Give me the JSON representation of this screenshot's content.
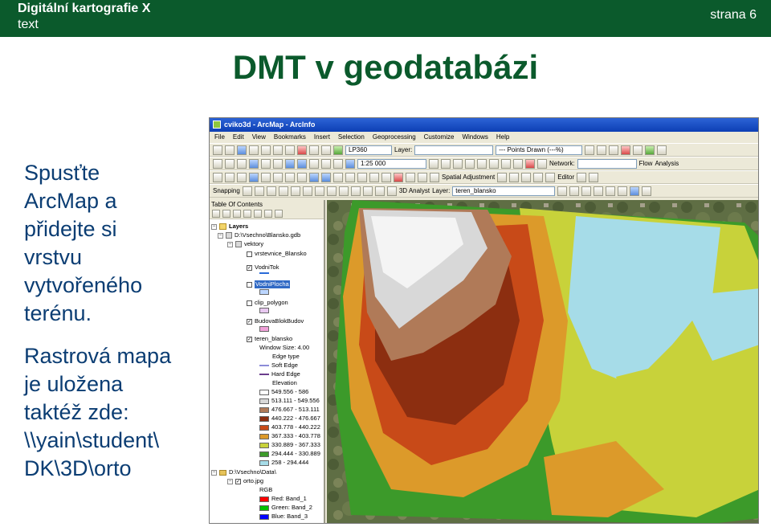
{
  "slide": {
    "course_title": "Digitální kartografie X",
    "subtitle": "text",
    "page_label": "strana 6",
    "heading": "DMT v geodatabázi",
    "paragraph1": "Spusťte\nArcMap a\npřidejte si\nvrstvu\nvytvořeného\nterénu.",
    "paragraph2": "Rastrová mapa\nje uložena\ntaktéž zde:\n\\\\yain\\student\\\nDK\\3D\\orto"
  },
  "arcmap": {
    "window_title": "cviko3d - ArcMap - ArcInfo",
    "menu": [
      "File",
      "Edit",
      "View",
      "Bookmarks",
      "Insert",
      "Selection",
      "Geoprocessing",
      "Customize",
      "Windows",
      "Help"
    ],
    "toolbar": {
      "layer_combo": "LP360",
      "layer_label": "Layer:",
      "points_drawn": "--- Points Drawn (---%)",
      "scale": "1:25 000",
      "network_label": "Network:",
      "flow_label": "Flow",
      "analysis_label": "Analysis",
      "snapping_label": "Snapping",
      "spatial_adjustment_label": "Spatial Adjustment",
      "editor_label": "Editor",
      "analyst_3d_label": "3D Analyst",
      "analyst_layer_label": "Layer:",
      "analyst_layer_value": "teren_blansko"
    },
    "toc": {
      "title": "Table Of Contents",
      "layers_root": "Layers",
      "gdb_path": "D:\\Vsechno\\Blansko.gdb",
      "vektory": "vektory",
      "vrstevnice": "vrstevnice_Blansko",
      "vodnitok": "VodniTok",
      "vodniplocha": "VodniPlocha",
      "clip_polygon": "clip_polygon",
      "budova": "BudovaBlokBudov",
      "teren": "teren_blansko",
      "window_size": "Window Size: 4.00",
      "edge_type": "Edge type",
      "soft_edge": "Soft Edge",
      "hard_edge": "Hard Edge",
      "elevation": "Elevation",
      "elevation_classes": [
        {
          "label": "549.556 - 586",
          "color": "#ffffff"
        },
        {
          "label": "513.111 - 549.556",
          "color": "#d8d8d8"
        },
        {
          "label": "476.667 - 513.111",
          "color": "#b07a58"
        },
        {
          "label": "440.222 - 476.667",
          "color": "#8c2e10"
        },
        {
          "label": "403.778 - 440.222",
          "color": "#c84a18"
        },
        {
          "label": "367.333 - 403.778",
          "color": "#dc9a2a"
        },
        {
          "label": "330.889 - 367.333",
          "color": "#c8d23a"
        },
        {
          "label": "294.444 - 330.889",
          "color": "#3c9a2a"
        },
        {
          "label": "258 - 294.444",
          "color": "#a6dce8"
        }
      ],
      "data_path": "D:\\Vsechno\\Data\\",
      "orto": "orto.jpg",
      "rgb": "RGB",
      "bands": [
        {
          "label": "Red:   Band_1",
          "color": "#ff0000"
        },
        {
          "label": "Green: Band_2",
          "color": "#00c000"
        },
        {
          "label": "Blue:  Band_3",
          "color": "#0000ff"
        }
      ]
    }
  }
}
